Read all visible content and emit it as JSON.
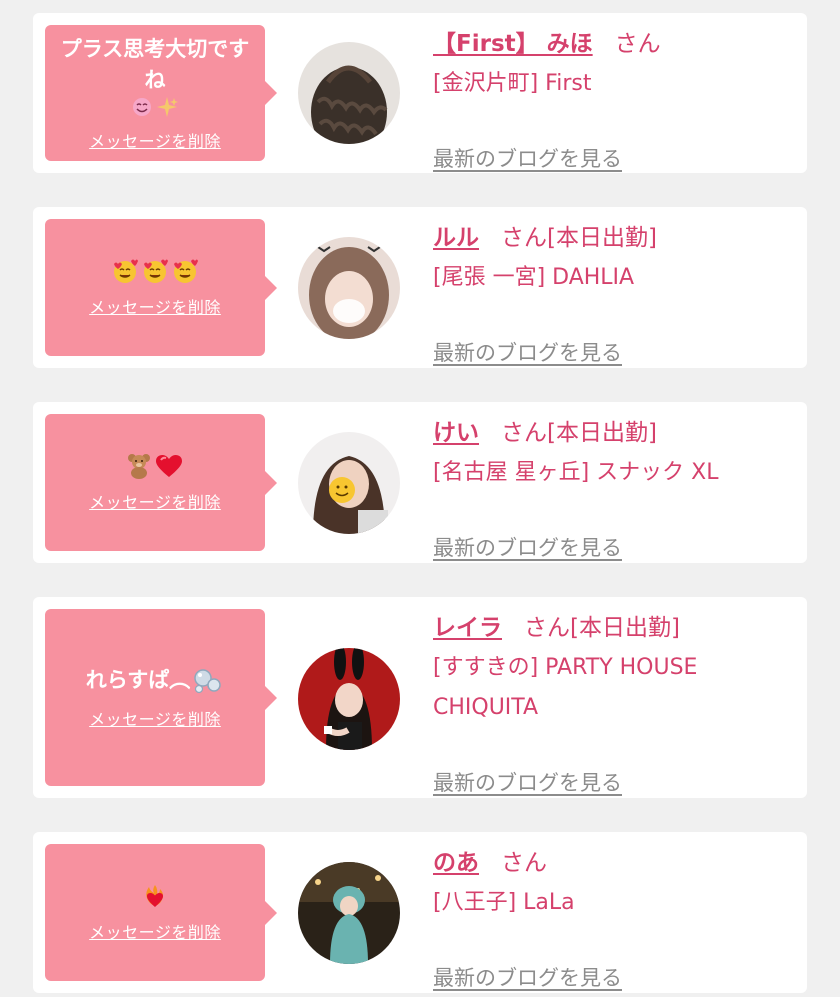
{
  "cards": [
    {
      "message": "プラス思考大切ですね",
      "message_emojis": [
        "smiling-face-icon",
        "sparkles-icon"
      ],
      "delete_label": "メッセージを削除",
      "name": "【First】 みほ",
      "suffix": "さん",
      "shop": "[金沢片町] First",
      "blog_label": "最新のブログを見る"
    },
    {
      "message": "",
      "message_emojis": [
        "smiling-face-with-hearts-icon",
        "smiling-face-with-hearts-icon",
        "smiling-face-with-hearts-icon"
      ],
      "delete_label": "メッセージを削除",
      "name": "ルル",
      "suffix": "さん[本日出勤]",
      "shop": "[尾張 一宮] DAHLIA",
      "blog_label": "最新のブログを見る"
    },
    {
      "message": "",
      "message_emojis": [
        "teddy-bear-icon",
        "red-heart-icon"
      ],
      "delete_label": "メッセージを削除",
      "name": "けい",
      "suffix": "さん[本日出勤]",
      "shop": "[名古屋 星ヶ丘] スナック XL",
      "blog_label": "最新のブログを見る"
    },
    {
      "message": "れらすぱ︵",
      "message_emojis": [
        "bubbles-icon"
      ],
      "delete_label": "メッセージを削除",
      "name": "レイラ",
      "suffix": "さん[本日出勤]",
      "shop": "[すすきの] PARTY HOUSE CHIQUITA",
      "blog_label": "最新のブログを見る"
    },
    {
      "message": "",
      "message_emojis": [
        "heart-on-fire-icon"
      ],
      "delete_label": "メッセージを削除",
      "name": "のあ",
      "suffix": "さん",
      "shop": "[八王子] LaLa",
      "blog_label": "最新のブログを見る"
    }
  ],
  "colors": {
    "accent": "#d5416c",
    "bubble": "#f7919f",
    "link_gray": "#8c8c8c",
    "background": "#f0f0f0"
  }
}
